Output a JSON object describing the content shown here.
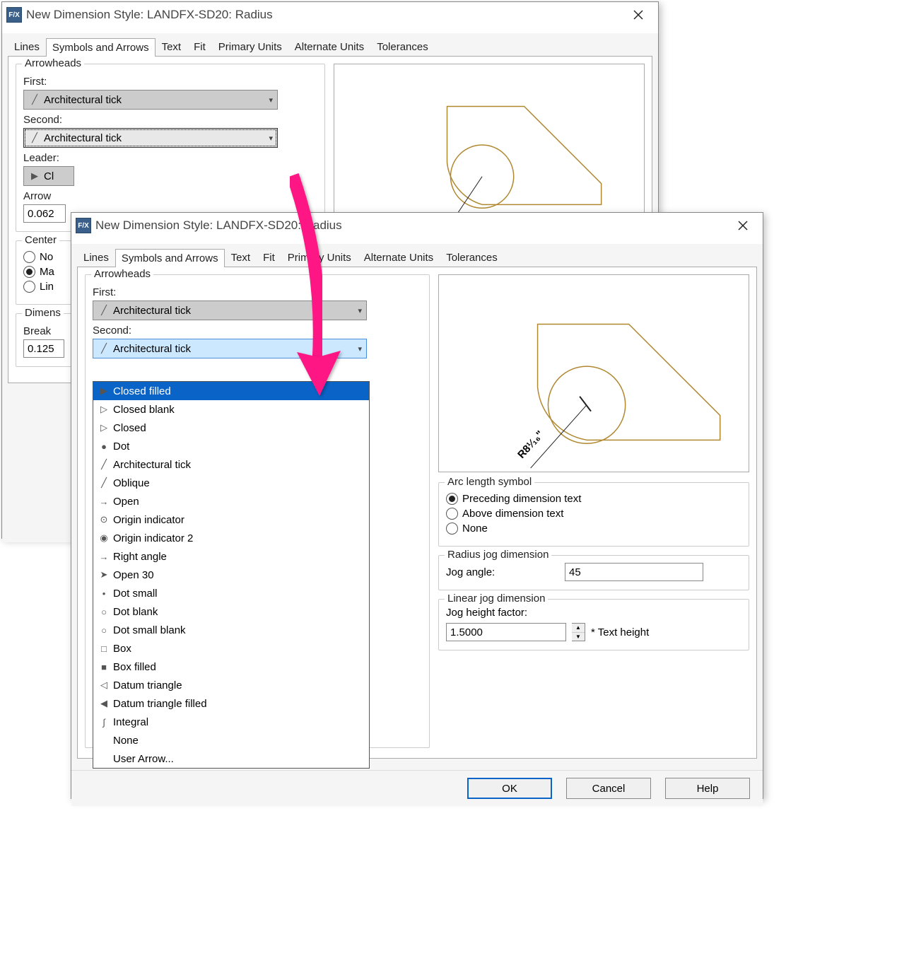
{
  "dialog1": {
    "title": "New Dimension Style: LANDFX-SD20: Radius",
    "tabs": [
      "Lines",
      "Symbols and Arrows",
      "Text",
      "Fit",
      "Primary Units",
      "Alternate Units",
      "Tolerances"
    ],
    "activeTab": "Symbols and Arrows",
    "arrowheads": {
      "legend": "Arrowheads",
      "firstLabel": "First:",
      "first": "Architectural tick",
      "secondLabel": "Second:",
      "second": "Architectural tick",
      "leaderLabel": "Leader:",
      "leader_partial": "Cl",
      "arrowLabel": "Arrow",
      "arrowSize": "0.062"
    },
    "centerMarks": {
      "legend_partial": "Center",
      "opts": [
        "No",
        "Ma",
        "Lin"
      ]
    },
    "dimens": {
      "legend_partial": "Dimens",
      "breakLabel": "Break",
      "breakVal": "0.125"
    }
  },
  "dialog2": {
    "title": "New Dimension Style: LANDFX-SD20: Radius",
    "tabs": [
      "Lines",
      "Symbols and Arrows",
      "Text",
      "Fit",
      "Primary Units",
      "Alternate Units",
      "Tolerances"
    ],
    "activeTab": "Symbols and Arrows",
    "arrowheads": {
      "legend": "Arrowheads",
      "firstLabel": "First:",
      "first": "Architectural tick",
      "secondLabel": "Second:",
      "secondSelected": "Architectural tick"
    },
    "dropdownOptions": [
      {
        "icon": "▶",
        "label": "Closed filled"
      },
      {
        "icon": "▷",
        "label": "Closed blank"
      },
      {
        "icon": "▷",
        "label": "Closed"
      },
      {
        "icon": "●",
        "label": "Dot"
      },
      {
        "icon": "╱",
        "label": "Architectural tick"
      },
      {
        "icon": "╱",
        "label": "Oblique"
      },
      {
        "icon": "→",
        "label": "Open"
      },
      {
        "icon": "⊙",
        "label": "Origin indicator"
      },
      {
        "icon": "◉",
        "label": "Origin indicator 2"
      },
      {
        "icon": "→",
        "label": "Right angle"
      },
      {
        "icon": "➤",
        "label": "Open 30"
      },
      {
        "icon": "•",
        "label": "Dot small"
      },
      {
        "icon": "○",
        "label": "Dot blank"
      },
      {
        "icon": "○",
        "label": "Dot small blank"
      },
      {
        "icon": "□",
        "label": "Box"
      },
      {
        "icon": "■",
        "label": "Box filled"
      },
      {
        "icon": "◁",
        "label": "Datum triangle"
      },
      {
        "icon": "◀",
        "label": "Datum triangle filled"
      },
      {
        "icon": "∫",
        "label": "Integral"
      },
      {
        "icon": "",
        "label": "None"
      },
      {
        "icon": "",
        "label": "User Arrow..."
      }
    ],
    "selectedOption": "Closed filled",
    "arcLength": {
      "legend": "Arc length symbol",
      "opts": [
        "Preceding dimension text",
        "Above dimension text",
        "None"
      ],
      "selected": "Preceding dimension text"
    },
    "radiusJog": {
      "legend": "Radius jog dimension",
      "label": "Jog angle:",
      "value": "45"
    },
    "linearJog": {
      "legend": "Linear jog dimension",
      "label": "Jog height factor:",
      "value": "1.5000",
      "suffix": "* Text height"
    },
    "previewLabel": "R8¹⁄₁₆\"",
    "buttons": {
      "ok": "OK",
      "cancel": "Cancel",
      "help": "Help"
    }
  }
}
